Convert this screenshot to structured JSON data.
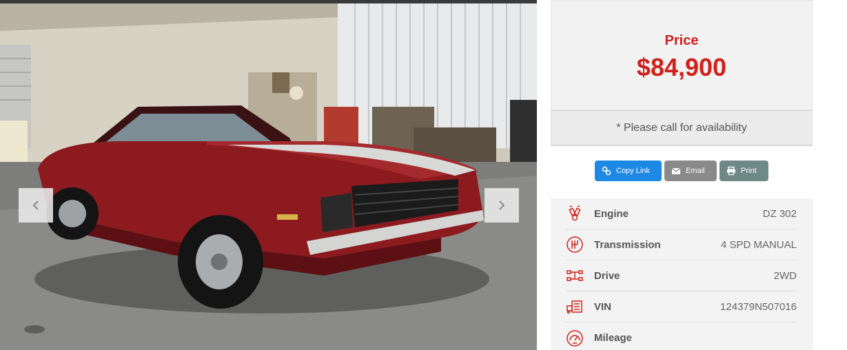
{
  "gallery": {
    "prev_label": "previous image",
    "next_label": "next image"
  },
  "price": {
    "label": "Price",
    "value": "$84,900"
  },
  "availability": "* Please call for availability",
  "actions": {
    "copy_link": "Copy Link",
    "email": "Email",
    "print": "Print"
  },
  "specs": [
    {
      "label": "Engine",
      "value": "DZ 302",
      "icon": "engine-icon"
    },
    {
      "label": "Transmission",
      "value": "4 SPD MANUAL",
      "icon": "transmission-icon"
    },
    {
      "label": "Drive",
      "value": "2WD",
      "icon": "drive-icon"
    },
    {
      "label": "VIN",
      "value": "124379N507016",
      "icon": "vin-icon"
    },
    {
      "label": "Mileage",
      "value": "",
      "icon": "speedometer-icon"
    }
  ],
  "colors": {
    "accent_red": "#d0201a",
    "copy_blue": "#1e88e5",
    "email_gray": "#8a8a8a",
    "print_teal": "#6f8a86",
    "car_red": "#8c1a1e"
  }
}
